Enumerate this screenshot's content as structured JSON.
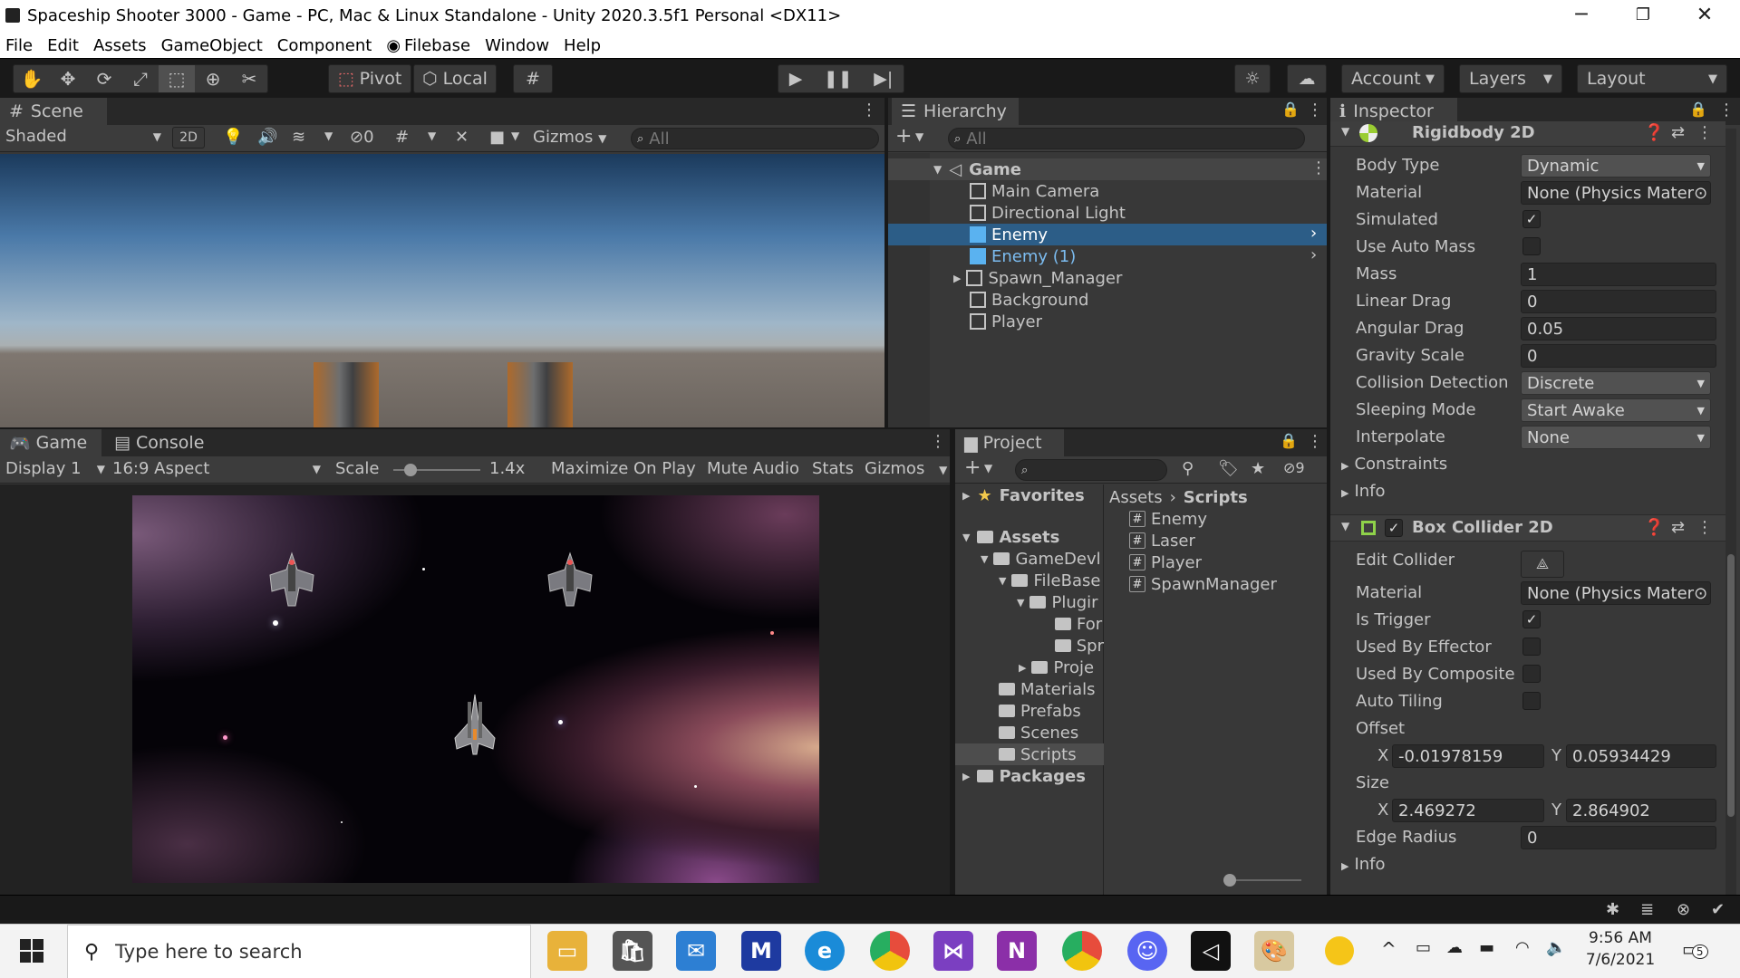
{
  "window": {
    "title": "Spaceship Shooter 3000 - Game - PC, Mac & Linux Standalone - Unity 2020.3.5f1 Personal <DX11>"
  },
  "menu": [
    "File",
    "Edit",
    "Assets",
    "GameObject",
    "Component",
    "Filebase",
    "Window",
    "Help"
  ],
  "toolbar": {
    "pivot": "Pivot",
    "local": "Local",
    "account": "Account",
    "layers": "Layers",
    "layout": "Layout"
  },
  "scene": {
    "tab": "Scene",
    "shading": "Shaded",
    "mode_2d": "2D",
    "hidden_count": "0",
    "gizmos": "Gizmos",
    "search_placeholder": "All"
  },
  "hierarchy": {
    "tab": "Hierarchy",
    "search_placeholder": "All",
    "root": "Game",
    "items": [
      {
        "label": "Main Camera"
      },
      {
        "label": "Directional Light"
      },
      {
        "label": "Enemy"
      },
      {
        "label": "Enemy (1)"
      },
      {
        "label": "Spawn_Manager"
      },
      {
        "label": "Background"
      },
      {
        "label": "Player"
      }
    ]
  },
  "game": {
    "tab_game": "Game",
    "tab_console": "Console",
    "display": "Display 1",
    "aspect": "16:9 Aspect",
    "scale_label": "Scale",
    "scale_value": "1.4x",
    "maximize": "Maximize On Play",
    "mute": "Mute Audio",
    "stats": "Stats",
    "gizmos": "Gizmos"
  },
  "project": {
    "tab": "Project",
    "hidden_count": "9",
    "favorites": "Favorites",
    "assets": "Assets",
    "packages": "Packages",
    "tree": [
      "GameDevl",
      "FileBase",
      "Plugir",
      "For",
      "Spr",
      "Proje",
      "Materials",
      "Prefabs",
      "Scenes",
      "Scripts"
    ],
    "breadcrumb_root": "Assets",
    "breadcrumb_current": "Scripts",
    "scripts": [
      "Enemy",
      "Laser",
      "Player",
      "SpawnManager"
    ]
  },
  "inspector": {
    "tab": "Inspector",
    "rigidbody": {
      "title": "Rigidbody 2D",
      "body_type_label": "Body Type",
      "body_type": "Dynamic",
      "material_label": "Material",
      "material": "None (Physics Mater",
      "simulated_label": "Simulated",
      "simulated": "✓",
      "use_auto_mass_label": "Use Auto Mass",
      "mass_label": "Mass",
      "mass": "1",
      "linear_drag_label": "Linear Drag",
      "linear_drag": "0",
      "angular_drag_label": "Angular Drag",
      "angular_drag": "0.05",
      "gravity_label": "Gravity Scale",
      "gravity": "0",
      "collision_label": "Collision Detection",
      "collision": "Discrete",
      "sleeping_label": "Sleeping Mode",
      "sleeping": "Start Awake",
      "interpolate_label": "Interpolate",
      "interpolate": "None",
      "constraints": "Constraints",
      "info": "Info"
    },
    "box": {
      "title": "Box Collider 2D",
      "edit_collider_label": "Edit Collider",
      "material_label": "Material",
      "material": "None (Physics Mater",
      "is_trigger_label": "Is Trigger",
      "is_trigger": "✓",
      "used_by_effector_label": "Used By Effector",
      "used_by_composite_label": "Used By Composite",
      "auto_tiling_label": "Auto Tiling",
      "offset_label": "Offset",
      "offset_x": "-0.01978159",
      "offset_y": "0.05934429",
      "size_label": "Size",
      "size_x": "2.469272",
      "size_y": "2.864902",
      "x": "X",
      "y": "Y",
      "edge_radius_label": "Edge Radius",
      "edge_radius": "0",
      "info": "Info"
    }
  },
  "taskbar": {
    "search_placeholder": "Type here to search",
    "time": "9:56 AM",
    "date": "7/6/2021",
    "notifications": "5"
  }
}
